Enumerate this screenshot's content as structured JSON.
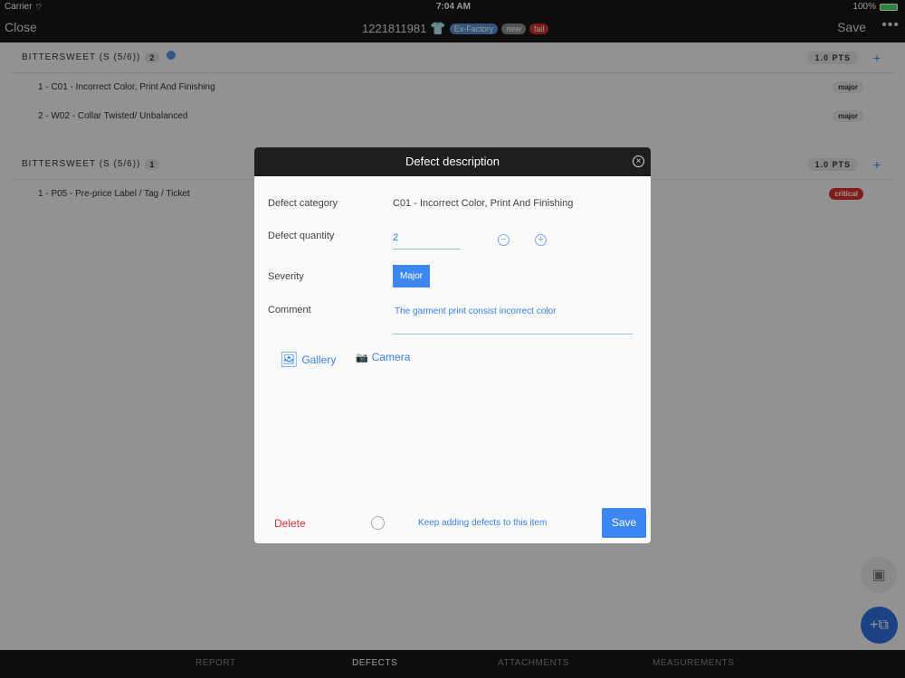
{
  "status_bar": {
    "carrier": "Carrier",
    "time": "7:04 AM",
    "battery": "100%"
  },
  "nav": {
    "close": "Close",
    "title": "1221811981",
    "badges": [
      {
        "label": "Ex-Factory",
        "color": "#5b8ecf"
      },
      {
        "label": "new",
        "color": "#8a8a8a"
      },
      {
        "label": "fail",
        "color": "#c9302c"
      }
    ],
    "save": "Save",
    "more": "•••"
  },
  "sections": [
    {
      "title": "BITTERSWEET (S (5/6))",
      "count": "2",
      "points": "1.0 PTS",
      "rows": [
        {
          "label": "1 - C01 - Incorrect Color, Print And Finishing",
          "severity": "major"
        },
        {
          "label": "2 - W02 - Collar Twisted/ Unbalanced",
          "severity": "major"
        }
      ]
    },
    {
      "title": "BITTERSWEET (S (5/6))",
      "count": "1",
      "points": "1.0 PTS",
      "rows": [
        {
          "label": "1 - P05 - Pre-price Label / Tag / Ticket",
          "severity": "critical"
        }
      ]
    }
  ],
  "modal": {
    "title": "Defect description",
    "category_label": "Defect category",
    "category_value": "C01 - Incorrect Color, Print And Finishing",
    "quantity_label": "Defect quantity",
    "quantity_value": "2",
    "severity_label": "Severity",
    "severity_value": "Major",
    "comment_label": "Comment",
    "comment_value": "The garment print consist incorrect color",
    "gallery": "Gallery",
    "camera": "Camera",
    "delete": "Delete",
    "keep_adding": "Keep adding defects to this item",
    "save": "Save"
  },
  "tabs": [
    "REPORT",
    "DEFECTS",
    "ATTACHMENTS",
    "MEASUREMENTS"
  ],
  "active_tab": "DEFECTS"
}
